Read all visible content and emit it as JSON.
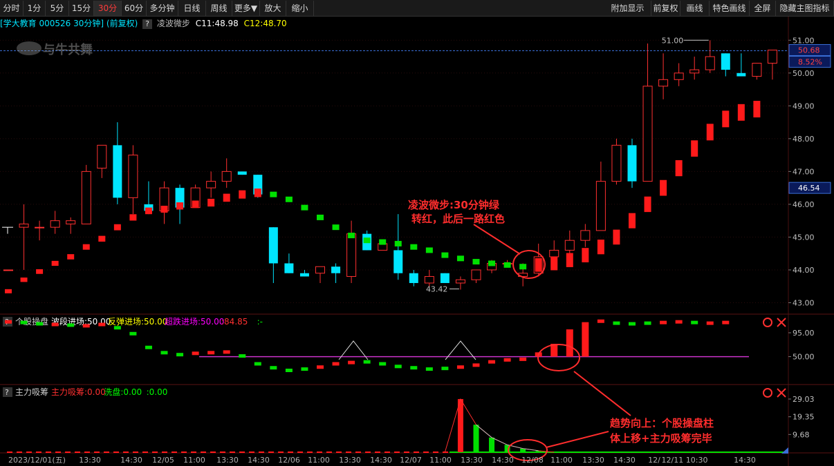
{
  "toolbar": {
    "left": [
      "分时",
      "1分",
      "5分",
      "15分",
      "30分",
      "60分",
      "多分钟",
      "日线",
      "周线",
      "更多▼",
      "放大",
      "缩小"
    ],
    "right": [
      "附加显示",
      "前复权",
      "画线",
      "特色画线",
      "全屏",
      "隐藏主图指标"
    ],
    "active": "30分"
  },
  "info": {
    "stock": "[学大教育 000526 30分钟] (前复权)",
    "indicator_name": "凌波微步",
    "c1": "C11:48.98",
    "c2": "C12:48.70"
  },
  "pane2": {
    "title": "个股操盘",
    "items": [
      {
        "text": "波段进场:50.00",
        "color": "#ffffff"
      },
      {
        "text": "反弹进场:50.00",
        "color": "#ffff00"
      },
      {
        "text": "超跌进场:50.00",
        "color": "#ff00ff"
      },
      {
        "text": ":84.85",
        "color": "#ff3030"
      },
      {
        "text": ":-",
        "color": "#00ff00"
      }
    ],
    "yticks": [
      "95.00",
      "50.00"
    ]
  },
  "pane3": {
    "title": "主力吸筹",
    "items": [
      {
        "text": "主力吸筹:0.00",
        "color": "#ff3030"
      },
      {
        "text": "洗盘:0.00",
        "color": "#00ff00"
      },
      {
        "text": ":0.00",
        "color": "#00ff00"
      }
    ],
    "yticks": [
      "29.03",
      "19.35",
      "9.68"
    ]
  },
  "main": {
    "yticks": [
      "51.00",
      "50.00",
      "49.00",
      "48.00",
      "47.00",
      "46.00",
      "45.00",
      "44.00",
      "43.00"
    ],
    "price_tag_top": "50.68",
    "pct_tag": "8.52%",
    "price_tag_mid": "46.54",
    "high_label": "51.00",
    "low_label": "43.42",
    "watermark": "与牛共舞"
  },
  "annotations": {
    "a1_line1": "凌波微步:30分钟绿",
    "a1_line2": "转红，此后一路红色",
    "a2_line1": "趋势向上：个股操盘柱",
    "a2_line2": "体上移+主力吸筹完毕"
  },
  "xaxis": [
    "2023/12/01(五)",
    "13:30",
    "14:30",
    "12/05",
    "11:00",
    "13:30",
    "14:30",
    "12/06",
    "11:00",
    "13:30",
    "14:30",
    "12/07",
    "11:00",
    "13:30",
    "14:30",
    "12/08",
    "11:00",
    "13:30",
    "14:30",
    "12/",
    "12/11 10:30",
    "14:30"
  ],
  "xaxis_highlight": "2023/12/11 10:30",
  "chart_data": {
    "type": "candlestick",
    "title": "学大教育 000526 30分钟",
    "ylim": [
      42.8,
      51.3
    ],
    "candles": [
      {
        "o": 44.0,
        "h": 44.0,
        "l": 44.0,
        "c": 44.0
      },
      {
        "o": 45.3,
        "h": 46.0,
        "l": 44.0,
        "c": 45.4
      },
      {
        "o": 45.3,
        "h": 45.5,
        "l": 44.9,
        "c": 45.3
      },
      {
        "o": 45.3,
        "h": 45.8,
        "l": 45.1,
        "c": 45.5
      },
      {
        "o": 45.4,
        "h": 45.6,
        "l": 45.1,
        "c": 45.5
      },
      {
        "o": 45.4,
        "h": 47.2,
        "l": 45.4,
        "c": 47.0
      },
      {
        "o": 47.1,
        "h": 47.8,
        "l": 46.8,
        "c": 47.8
      },
      {
        "o": 47.8,
        "h": 48.5,
        "l": 46.0,
        "c": 46.2
      },
      {
        "o": 46.2,
        "h": 47.8,
        "l": 45.7,
        "c": 47.5
      },
      {
        "o": 46.0,
        "h": 46.7,
        "l": 45.7,
        "c": 45.8
      },
      {
        "o": 45.8,
        "h": 46.7,
        "l": 45.4,
        "c": 46.5
      },
      {
        "o": 46.5,
        "h": 46.6,
        "l": 45.4,
        "c": 45.9
      },
      {
        "o": 45.9,
        "h": 46.6,
        "l": 45.9,
        "c": 46.5
      },
      {
        "o": 46.5,
        "h": 47.0,
        "l": 46.2,
        "c": 46.7
      },
      {
        "o": 46.7,
        "h": 47.4,
        "l": 46.5,
        "c": 47.0
      },
      {
        "o": 47.0,
        "h": 47.0,
        "l": 46.9,
        "c": 46.9
      },
      {
        "o": 46.9,
        "h": 46.9,
        "l": 46.2,
        "c": 46.3
      },
      {
        "o": 45.3,
        "h": 45.3,
        "l": 43.6,
        "c": 44.2
      },
      {
        "o": 44.2,
        "h": 44.5,
        "l": 43.9,
        "c": 43.9
      },
      {
        "o": 43.9,
        "h": 44.0,
        "l": 43.8,
        "c": 43.8
      },
      {
        "o": 43.9,
        "h": 44.1,
        "l": 43.6,
        "c": 44.1
      },
      {
        "o": 44.1,
        "h": 44.2,
        "l": 43.6,
        "c": 43.9
      },
      {
        "o": 43.8,
        "h": 45.5,
        "l": 43.6,
        "c": 45.1
      },
      {
        "o": 45.1,
        "h": 45.2,
        "l": 44.6,
        "c": 44.6
      },
      {
        "o": 44.6,
        "h": 44.9,
        "l": 44.6,
        "c": 44.8
      },
      {
        "o": 44.6,
        "h": 45.7,
        "l": 43.7,
        "c": 43.9
      },
      {
        "o": 43.9,
        "h": 44.0,
        "l": 43.5,
        "c": 43.6
      },
      {
        "o": 43.6,
        "h": 44.0,
        "l": 43.5,
        "c": 43.8
      },
      {
        "o": 43.9,
        "h": 43.9,
        "l": 43.6,
        "c": 43.6
      },
      {
        "o": 43.6,
        "h": 43.8,
        "l": 43.4,
        "c": 43.7
      },
      {
        "o": 43.7,
        "h": 44.0,
        "l": 43.6,
        "c": 44.0
      },
      {
        "o": 44.0,
        "h": 44.3,
        "l": 43.9,
        "c": 44.2
      },
      {
        "o": 44.2,
        "h": 44.3,
        "l": 44.1,
        "c": 44.2
      },
      {
        "o": 43.8,
        "h": 44.2,
        "l": 43.5,
        "c": 43.9
      },
      {
        "o": 43.9,
        "h": 44.8,
        "l": 43.8,
        "c": 44.4
      },
      {
        "o": 44.4,
        "h": 44.9,
        "l": 44.2,
        "c": 44.6
      },
      {
        "o": 44.6,
        "h": 45.2,
        "l": 44.5,
        "c": 44.9
      },
      {
        "o": 44.9,
        "h": 45.4,
        "l": 44.7,
        "c": 45.2
      },
      {
        "o": 45.2,
        "h": 47.3,
        "l": 45.2,
        "c": 46.7
      },
      {
        "o": 46.7,
        "h": 48.0,
        "l": 46.6,
        "c": 47.8
      },
      {
        "o": 47.8,
        "h": 48.0,
        "l": 46.5,
        "c": 46.7
      },
      {
        "o": 46.7,
        "h": 50.9,
        "l": 46.7,
        "c": 49.6
      },
      {
        "o": 49.6,
        "h": 50.6,
        "l": 49.2,
        "c": 49.8
      },
      {
        "o": 49.8,
        "h": 50.3,
        "l": 49.6,
        "c": 50.0
      },
      {
        "o": 50.0,
        "h": 50.5,
        "l": 49.8,
        "c": 50.1
      },
      {
        "o": 50.1,
        "h": 51.0,
        "l": 50.0,
        "c": 50.5
      },
      {
        "o": 50.6,
        "h": 50.6,
        "l": 49.9,
        "c": 50.1
      },
      {
        "o": 50.0,
        "h": 50.6,
        "l": 49.9,
        "c": 49.9
      },
      {
        "o": 49.9,
        "h": 50.3,
        "l": 49.8,
        "c": 50.3
      },
      {
        "o": 50.3,
        "h": 50.7,
        "l": 49.8,
        "c": 50.7
      }
    ],
    "step_line": [
      {
        "v": 43.35,
        "c": "r"
      },
      {
        "v": 43.7,
        "c": "r"
      },
      {
        "v": 43.95,
        "c": "r"
      },
      {
        "v": 44.2,
        "c": "r"
      },
      {
        "v": 44.4,
        "c": "r"
      },
      {
        "v": 44.7,
        "c": "r"
      },
      {
        "v": 44.95,
        "c": "r"
      },
      {
        "v": 45.3,
        "c": "r"
      },
      {
        "v": 45.6,
        "c": "r"
      },
      {
        "v": 45.8,
        "c": "r"
      },
      {
        "v": 45.85,
        "c": "r"
      },
      {
        "v": 45.95,
        "c": "r"
      },
      {
        "v": 46.0,
        "c": "r"
      },
      {
        "v": 46.05,
        "c": "r"
      },
      {
        "v": 46.2,
        "c": "r"
      },
      {
        "v": 46.3,
        "c": "r"
      },
      {
        "v": 46.35,
        "c": "r"
      },
      {
        "v": 46.3,
        "c": "g"
      },
      {
        "v": 46.15,
        "c": "g"
      },
      {
        "v": 45.9,
        "c": "g"
      },
      {
        "v": 45.6,
        "c": "g"
      },
      {
        "v": 45.3,
        "c": "g"
      },
      {
        "v": 45.05,
        "c": "g"
      },
      {
        "v": 44.9,
        "c": "g"
      },
      {
        "v": 44.85,
        "c": "g"
      },
      {
        "v": 44.8,
        "c": "g"
      },
      {
        "v": 44.7,
        "c": "g"
      },
      {
        "v": 44.6,
        "c": "g"
      },
      {
        "v": 44.45,
        "c": "g"
      },
      {
        "v": 44.35,
        "c": "g"
      },
      {
        "v": 44.25,
        "c": "g"
      },
      {
        "v": 44.2,
        "c": "g"
      },
      {
        "v": 44.15,
        "c": "g"
      },
      {
        "v": 44.1,
        "c": "g"
      },
      {
        "v": 44.15,
        "c": "r"
      },
      {
        "v": 44.2,
        "c": "r"
      },
      {
        "v": 44.3,
        "c": "r"
      },
      {
        "v": 44.45,
        "c": "r"
      },
      {
        "v": 44.7,
        "c": "r"
      },
      {
        "v": 45.0,
        "c": "r"
      },
      {
        "v": 45.5,
        "c": "r"
      },
      {
        "v": 46.0,
        "c": "r"
      },
      {
        "v": 46.5,
        "c": "r"
      },
      {
        "v": 47.1,
        "c": "r"
      },
      {
        "v": 47.7,
        "c": "r"
      },
      {
        "v": 48.2,
        "c": "r"
      },
      {
        "v": 48.6,
        "c": "r"
      },
      {
        "v": 48.8,
        "c": "r"
      },
      {
        "v": 48.9,
        "c": "r"
      }
    ],
    "pane2_dots": [
      {
        "v": 94,
        "c": "r"
      },
      {
        "v": 93,
        "c": "g"
      },
      {
        "v": 91,
        "c": "g"
      },
      {
        "v": 90,
        "c": "r"
      },
      {
        "v": 89,
        "c": "g"
      },
      {
        "v": 88,
        "c": "r"
      },
      {
        "v": 90,
        "c": "r"
      },
      {
        "v": 85,
        "c": "g"
      },
      {
        "v": 76,
        "c": "g"
      },
      {
        "v": 55,
        "c": "g"
      },
      {
        "v": 47,
        "c": "g"
      },
      {
        "v": 44,
        "c": "g"
      },
      {
        "v": 46,
        "c": "r"
      },
      {
        "v": 47,
        "c": "r"
      },
      {
        "v": 48,
        "c": "r"
      },
      {
        "v": 42,
        "c": "g"
      },
      {
        "v": 30,
        "c": "g"
      },
      {
        "v": 24,
        "c": "g"
      },
      {
        "v": 20,
        "c": "g"
      },
      {
        "v": 22,
        "c": "g"
      },
      {
        "v": 25,
        "c": "r"
      },
      {
        "v": 30,
        "c": "r"
      },
      {
        "v": 32,
        "c": "r"
      },
      {
        "v": 33,
        "c": "g"
      },
      {
        "v": 30,
        "c": "g"
      },
      {
        "v": 26,
        "c": "g"
      },
      {
        "v": 24,
        "c": "g"
      },
      {
        "v": 22,
        "c": "g"
      },
      {
        "v": 23,
        "c": "g"
      },
      {
        "v": 25,
        "c": "r"
      },
      {
        "v": 28,
        "c": "r"
      },
      {
        "v": 33,
        "c": "r"
      },
      {
        "v": 36,
        "c": "r"
      },
      {
        "v": 37,
        "c": "r"
      },
      {
        "v": 47,
        "c": "r"
      },
      {
        "v": 60,
        "c": "r"
      },
      {
        "v": 82,
        "c": "r"
      },
      {
        "v": 93,
        "c": "r"
      },
      {
        "v": 95,
        "c": "r"
      },
      {
        "v": 92,
        "c": "g"
      },
      {
        "v": 91,
        "c": "g"
      },
      {
        "v": 92,
        "c": "g"
      },
      {
        "v": 93,
        "c": "r"
      },
      {
        "v": 94,
        "c": "r"
      },
      {
        "v": 93,
        "c": "g"
      },
      {
        "v": 92,
        "c": "r"
      },
      {
        "v": 93,
        "c": "r"
      }
    ],
    "pane3_bars": [
      {
        "v": 29.0,
        "c": "r"
      },
      {
        "v": 15.0,
        "c": "g"
      },
      {
        "v": 8.0,
        "c": "g"
      },
      {
        "v": 4.0,
        "c": "g"
      },
      {
        "v": 2.0,
        "c": "g"
      },
      {
        "v": 0.8,
        "c": "g"
      }
    ]
  }
}
